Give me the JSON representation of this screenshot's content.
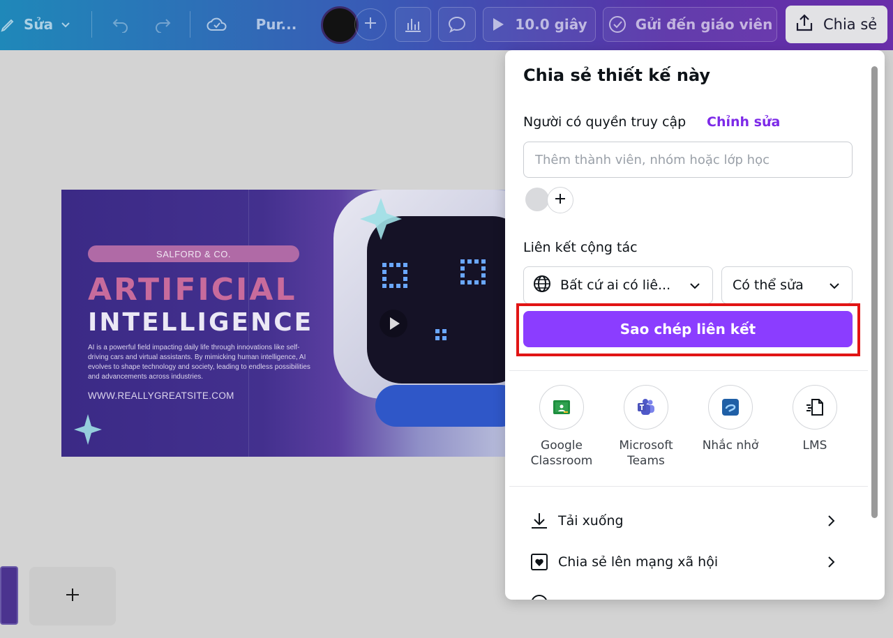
{
  "topbar": {
    "edit_label": "Sửa",
    "project_name": "Pur...",
    "duration_label": "10.0 giây",
    "send_teacher_label": "Gửi đến giáo viên",
    "share_label": "Chia sẻ",
    "color_swatch": "#121212"
  },
  "design": {
    "company_pill": "SALFORD & CO.",
    "title_line1": "ARTIFICIAL",
    "title_line2": "INTELLIGENCE",
    "body": "AI is a powerful field impacting daily life through innovations like self-driving cars and virtual assistants. By mimicking human intelligence, AI evolves to shape technology and society, leading to endless possibilities and advancements across industries.",
    "website": "WWW.REALLYGREATSITE.COM"
  },
  "panel": {
    "title": "Chia sẻ thiết kế này",
    "access_label": "Người có quyền truy cập",
    "access_edit_link": "Chỉnh sửa",
    "member_input_placeholder": "Thêm thành viên, nhóm hoặc lớp học",
    "collab_link_label": "Liên kết cộng tác",
    "access_dropdown": "Bất cứ ai có liê...",
    "permission_dropdown": "Có thể sửa",
    "copy_link_button": "Sao chép liên kết",
    "apps": [
      {
        "line1": "Google",
        "line2": "Classroom",
        "icon": "google-classroom-icon"
      },
      {
        "line1": "Microsoft",
        "line2": "Teams",
        "icon": "microsoft-teams-icon"
      },
      {
        "line1": "Nhắc nhở",
        "line2": "",
        "icon": "reminders-icon"
      },
      {
        "line1": "LMS",
        "line2": "",
        "icon": "lms-icon"
      }
    ],
    "menu": [
      {
        "label": "Tải xuống",
        "icon": "download-icon"
      },
      {
        "label": "Chia sẻ lên mạng xã hội",
        "icon": "social-share-icon"
      }
    ]
  },
  "colors": {
    "accent": "#8b3dff",
    "link": "#7d2ae8",
    "highlight": "#e11515"
  }
}
